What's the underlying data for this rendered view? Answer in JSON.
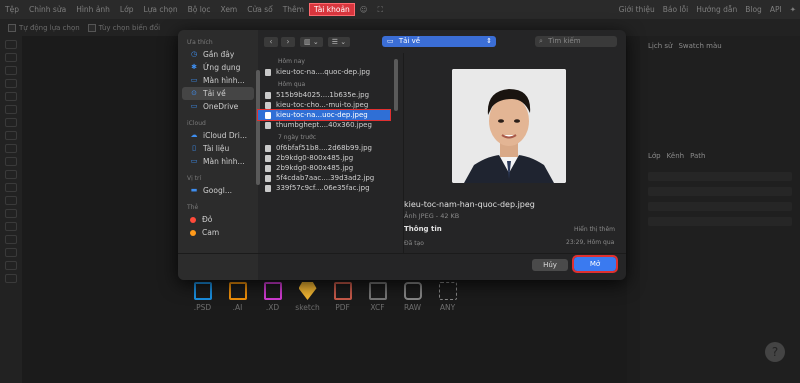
{
  "menu": [
    "Tệp",
    "Chỉnh sửa",
    "Hình ảnh",
    "Lớp",
    "Lựa chọn",
    "Bộ lọc",
    "Xem",
    "Cửa sổ",
    "Thêm",
    "Tài khoản"
  ],
  "menu_right": [
    "Giới thiệu",
    "Báo lỗi",
    "Hướng dẫn",
    "Blog",
    "API"
  ],
  "optbar": {
    "auto_select": "Tự động lựa chọn",
    "transform": "Tùy chọn biến đổi"
  },
  "rpanel": {
    "tab_history": "Lịch sử",
    "tab_swatch": "Swatch màu",
    "tab_layer": "Lớp",
    "tab_channel": "Kênh",
    "tab_path": "Path"
  },
  "dialog": {
    "sidebar": {
      "sec_favorites": "Ưa thích",
      "favorites": [
        "Gần đây",
        "Ứng dụng",
        "Màn hình...",
        "Tải về",
        "OneDrive"
      ],
      "sec_icloud": "iCloud",
      "icloud": [
        "iCloud Dri...",
        "Tài liệu",
        "Màn hình..."
      ],
      "sec_locations": "Vị trí",
      "locations": [
        "Googl..."
      ],
      "sec_tags": "Thẻ",
      "tags": [
        {
          "label": "Đỏ",
          "color": "#ff4a3a"
        },
        {
          "label": "Cam",
          "color": "#ff9a1a"
        }
      ]
    },
    "location": "Tải về",
    "search_placeholder": "Tìm kiếm",
    "groups": [
      {
        "label": "Hôm nay",
        "files": [
          "kieu-toc-na....quoc-dep.jpg"
        ]
      },
      {
        "label": "Hôm qua",
        "files": [
          "515b9b4025....1b635e.jpg",
          "kieu-toc-cho...-mui-to.jpeg",
          "kieu-toc-na...uoc-dep.jpeg",
          "thumbghept....40x360.jpeg"
        ]
      },
      {
        "label": "7 ngày trước",
        "files": [
          "0f6bfaf51b8....2d68b99.jpg",
          "2b9kdg0-800x485.jpg",
          "2b9kdg0-800x485.jpg",
          "5f4cdab7aac....39d3ad2.jpg",
          "339f57c9cf....06e35fac.jpg"
        ]
      }
    ],
    "selected_file": "kieu-toc-na...uoc-dep.jpeg",
    "preview": {
      "name": "kieu-toc-nam-han-quoc-dep.jpeg",
      "kind": "Ảnh JPEG - 42 KB",
      "info_title": "Thông tin",
      "show_more": "Hiển thị thêm",
      "created_label": "Đã tạo",
      "created_value": "23:29, Hôm qua"
    },
    "cancel": "Hủy",
    "open": "Mở"
  },
  "formats": [
    {
      "label": ".PSD",
      "color": "#1a8fe0"
    },
    {
      "label": ".AI",
      "color": "#f0900a"
    },
    {
      "label": ".XD",
      "color": "#d13bd3"
    },
    {
      "label": "sketch",
      "color": "#f2b632"
    },
    {
      "label": "PDF",
      "color": "#c85a4a"
    },
    {
      "label": "XCF",
      "color": "#777777"
    },
    {
      "label": "RAW",
      "color": "#888888"
    },
    {
      "label": "ANY",
      "color": "#888888"
    }
  ]
}
